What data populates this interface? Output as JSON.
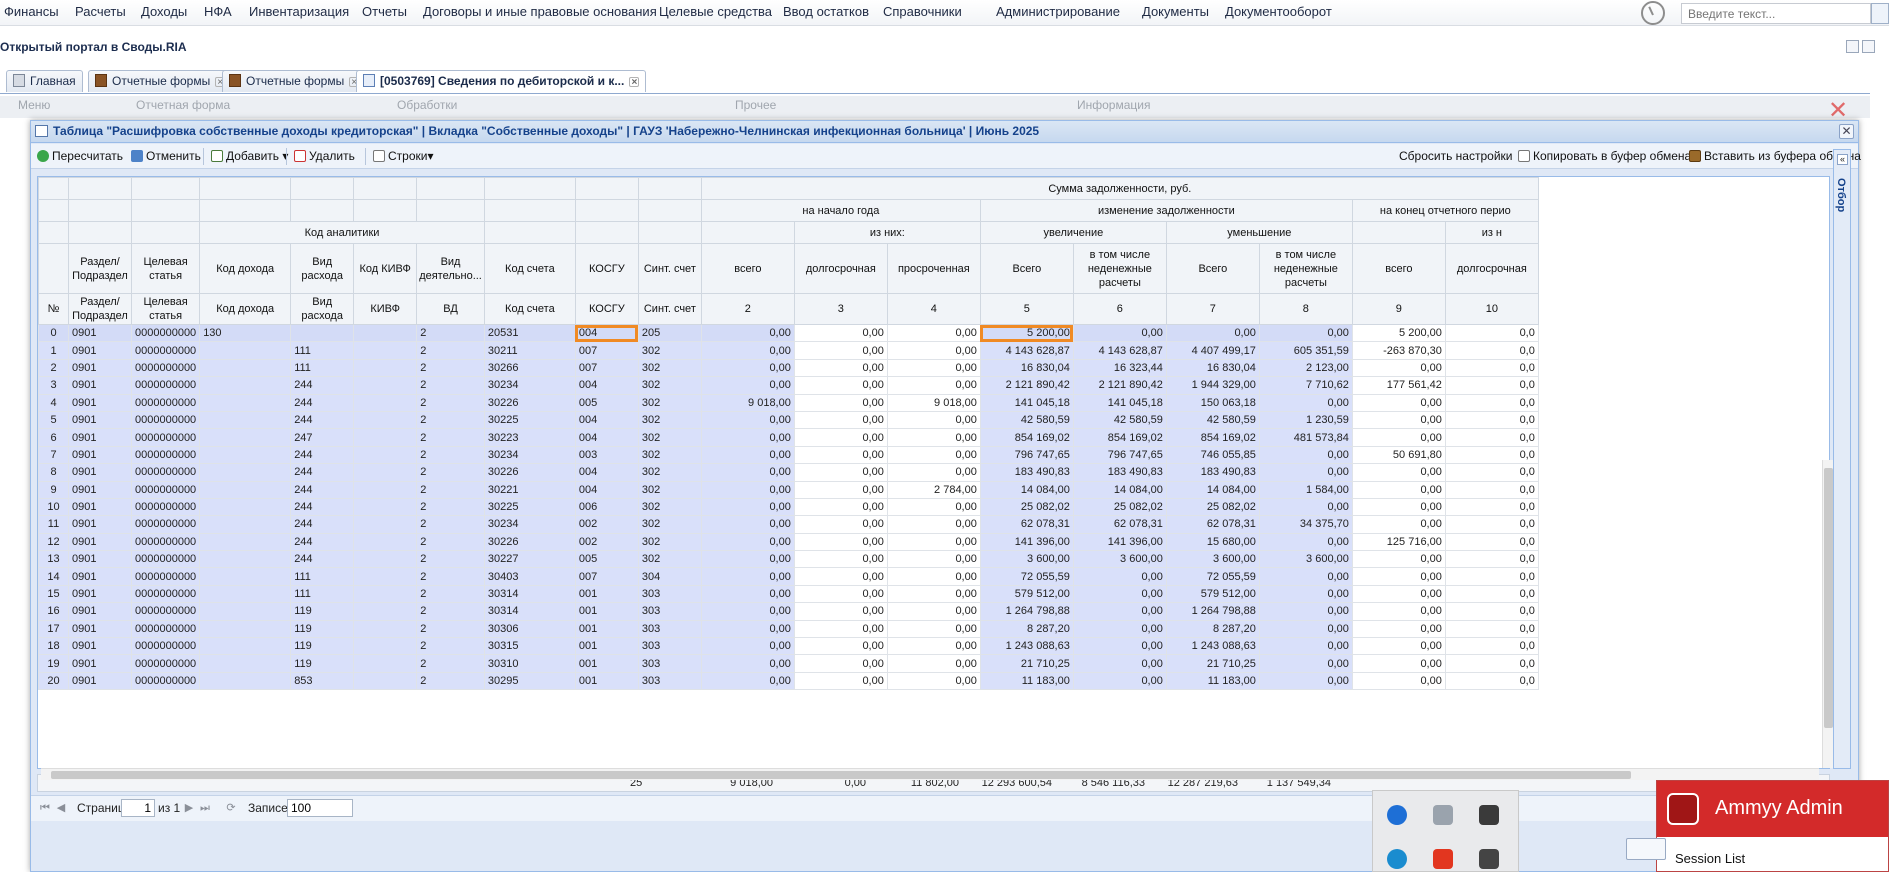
{
  "top_menu": {
    "items": [
      "Финансы",
      "Расчеты",
      "Доходы",
      "НФА",
      "Инвентаризация",
      "Отчеты",
      "Договоры и иные правовые основания",
      "Целевые средства",
      "Ввод остатков",
      "Справочники",
      "Администрирование",
      "Документы",
      "Документооборот"
    ],
    "search_placeholder": "Введите текст..."
  },
  "portal_title": "Открытый портал в Своды.RIA",
  "tabs": [
    {
      "label": "Главная"
    },
    {
      "label": "Отчетные формы"
    },
    {
      "label": "Отчетные формы"
    },
    {
      "label": "[0503769] Сведения по дебиторской и к..."
    }
  ],
  "ribbon": {
    "groups": [
      "Меню",
      "Отчетная форма",
      "Обработки",
      "Прочее",
      "Информация"
    ]
  },
  "modal": {
    "title": "Таблица \"Расшифровка собственные доходы кредиторская\" | Вкладка \"Собственные доходы\" | ГАУЗ 'Набережно-Челнинская инфекционная больница' | Июнь 2025",
    "toolbar": {
      "recalc": "Пересчитать",
      "cancel": "Отменить",
      "add": "Добавить",
      "delete": "Удалить",
      "rows": "Строки",
      "reset": "Сбросить настройки",
      "copy": "Копировать в буфер обмена",
      "paste": "Вставить из буфера обмена"
    },
    "side_filter": "Отбор"
  },
  "grid": {
    "header": {
      "sum_group": "Сумма задолженности, руб.",
      "start_year": "на начало года",
      "of_them": "из них:",
      "change": "изменение задолженности",
      "end_period": "на конец отчетного перио",
      "code_analytics": "Код аналитики",
      "increase": "увеличение",
      "decrease": "уменьшение",
      "of_them_end": "из н"
    },
    "columns": [
      {
        "h1": "",
        "h2": "№"
      },
      {
        "h1": "Раздел/ Подраздел",
        "h2": "Раздел/ Подраздел"
      },
      {
        "h1": "Целевая статья",
        "h2": "Целевая статья"
      },
      {
        "h1": "Код дохода",
        "h2": "Код дохода"
      },
      {
        "h1": "Вид расхода",
        "h2": "Вид расхода"
      },
      {
        "h1": "Код КИВФ",
        "h2": "КИВФ"
      },
      {
        "h1": "Вид деятельно...",
        "h2": "ВД"
      },
      {
        "h1": "Код счета",
        "h2": "Код счета"
      },
      {
        "h1": "КОСГУ",
        "h2": "КОСГУ"
      },
      {
        "h1": "Синт. счет",
        "h2": "Синт. счет"
      },
      {
        "h1": "всего",
        "h2": "2"
      },
      {
        "h1": "долгосрочная",
        "h2": "3"
      },
      {
        "h1": "просроченная",
        "h2": "4"
      },
      {
        "h1": "Всего",
        "h2": "5"
      },
      {
        "h1": "в том числе неденежные расчеты",
        "h2": "6"
      },
      {
        "h1": "Всего",
        "h2": "7"
      },
      {
        "h1": "в том числе неденежные расчеты",
        "h2": "8"
      },
      {
        "h1": "всего",
        "h2": "9"
      },
      {
        "h1": "долгосрочная",
        "h2": "10"
      }
    ],
    "rows": [
      [
        "0",
        "0901",
        "0000000000",
        "130",
        "",
        "",
        "2",
        "20531",
        "004",
        "205",
        "0,00",
        "0,00",
        "0,00",
        "5 200,00",
        "0,00",
        "0,00",
        "0,00",
        "5 200,00",
        "0,0"
      ],
      [
        "1",
        "0901",
        "0000000000",
        "",
        "111",
        "",
        "2",
        "30211",
        "007",
        "302",
        "0,00",
        "0,00",
        "0,00",
        "4 143 628,87",
        "4 143 628,87",
        "4 407 499,17",
        "605 351,59",
        "-263 870,30",
        "0,0"
      ],
      [
        "2",
        "0901",
        "0000000000",
        "",
        "111",
        "",
        "2",
        "30266",
        "007",
        "302",
        "0,00",
        "0,00",
        "0,00",
        "16 830,04",
        "16 323,44",
        "16 830,04",
        "2 123,00",
        "0,00",
        "0,0"
      ],
      [
        "3",
        "0901",
        "0000000000",
        "",
        "244",
        "",
        "2",
        "30234",
        "004",
        "302",
        "0,00",
        "0,00",
        "0,00",
        "2 121 890,42",
        "2 121 890,42",
        "1 944 329,00",
        "7 710,62",
        "177 561,42",
        "0,0"
      ],
      [
        "4",
        "0901",
        "0000000000",
        "",
        "244",
        "",
        "2",
        "30226",
        "005",
        "302",
        "9 018,00",
        "0,00",
        "9 018,00",
        "141 045,18",
        "141 045,18",
        "150 063,18",
        "0,00",
        "0,00",
        "0,0"
      ],
      [
        "5",
        "0901",
        "0000000000",
        "",
        "244",
        "",
        "2",
        "30225",
        "004",
        "302",
        "0,00",
        "0,00",
        "0,00",
        "42 580,59",
        "42 580,59",
        "42 580,59",
        "1 230,59",
        "0,00",
        "0,0"
      ],
      [
        "6",
        "0901",
        "0000000000",
        "",
        "247",
        "",
        "2",
        "30223",
        "004",
        "302",
        "0,00",
        "0,00",
        "0,00",
        "854 169,02",
        "854 169,02",
        "854 169,02",
        "481 573,84",
        "0,00",
        "0,0"
      ],
      [
        "7",
        "0901",
        "0000000000",
        "",
        "244",
        "",
        "2",
        "30234",
        "003",
        "302",
        "0,00",
        "0,00",
        "0,00",
        "796 747,65",
        "796 747,65",
        "746 055,85",
        "0,00",
        "50 691,80",
        "0,0"
      ],
      [
        "8",
        "0901",
        "0000000000",
        "",
        "244",
        "",
        "2",
        "30226",
        "004",
        "302",
        "0,00",
        "0,00",
        "0,00",
        "183 490,83",
        "183 490,83",
        "183 490,83",
        "0,00",
        "0,00",
        "0,0"
      ],
      [
        "9",
        "0901",
        "0000000000",
        "",
        "244",
        "",
        "2",
        "30221",
        "004",
        "302",
        "0,00",
        "0,00",
        "2 784,00",
        "14 084,00",
        "14 084,00",
        "14 084,00",
        "1 584,00",
        "0,00",
        "0,0"
      ],
      [
        "10",
        "0901",
        "0000000000",
        "",
        "244",
        "",
        "2",
        "30225",
        "006",
        "302",
        "0,00",
        "0,00",
        "0,00",
        "25 082,02",
        "25 082,02",
        "25 082,02",
        "0,00",
        "0,00",
        "0,0"
      ],
      [
        "11",
        "0901",
        "0000000000",
        "",
        "244",
        "",
        "2",
        "30234",
        "002",
        "302",
        "0,00",
        "0,00",
        "0,00",
        "62 078,31",
        "62 078,31",
        "62 078,31",
        "34 375,70",
        "0,00",
        "0,0"
      ],
      [
        "12",
        "0901",
        "0000000000",
        "",
        "244",
        "",
        "2",
        "30226",
        "002",
        "302",
        "0,00",
        "0,00",
        "0,00",
        "141 396,00",
        "141 396,00",
        "15 680,00",
        "0,00",
        "125 716,00",
        "0,0"
      ],
      [
        "13",
        "0901",
        "0000000000",
        "",
        "244",
        "",
        "2",
        "30227",
        "005",
        "302",
        "0,00",
        "0,00",
        "0,00",
        "3 600,00",
        "3 600,00",
        "3 600,00",
        "3 600,00",
        "0,00",
        "0,0"
      ],
      [
        "14",
        "0901",
        "0000000000",
        "",
        "111",
        "",
        "2",
        "30403",
        "007",
        "304",
        "0,00",
        "0,00",
        "0,00",
        "72 055,59",
        "0,00",
        "72 055,59",
        "0,00",
        "0,00",
        "0,0"
      ],
      [
        "15",
        "0901",
        "0000000000",
        "",
        "111",
        "",
        "2",
        "30314",
        "001",
        "303",
        "0,00",
        "0,00",
        "0,00",
        "579 512,00",
        "0,00",
        "579 512,00",
        "0,00",
        "0,00",
        "0,0"
      ],
      [
        "16",
        "0901",
        "0000000000",
        "",
        "119",
        "",
        "2",
        "30314",
        "001",
        "303",
        "0,00",
        "0,00",
        "0,00",
        "1 264 798,88",
        "0,00",
        "1 264 798,88",
        "0,00",
        "0,00",
        "0,0"
      ],
      [
        "17",
        "0901",
        "0000000000",
        "",
        "119",
        "",
        "2",
        "30306",
        "001",
        "303",
        "0,00",
        "0,00",
        "0,00",
        "8 287,20",
        "0,00",
        "8 287,20",
        "0,00",
        "0,00",
        "0,0"
      ],
      [
        "18",
        "0901",
        "0000000000",
        "",
        "119",
        "",
        "2",
        "30315",
        "001",
        "303",
        "0,00",
        "0,00",
        "0,00",
        "1 243 088,63",
        "0,00",
        "1 243 088,63",
        "0,00",
        "0,00",
        "0,0"
      ],
      [
        "19",
        "0901",
        "0000000000",
        "",
        "119",
        "",
        "2",
        "30310",
        "001",
        "303",
        "0,00",
        "0,00",
        "0,00",
        "21 710,25",
        "0,00",
        "21 710,25",
        "0,00",
        "0,00",
        "0,0"
      ],
      [
        "20",
        "0901",
        "0000000000",
        "",
        "853",
        "",
        "2",
        "30295",
        "001",
        "303",
        "0,00",
        "0,00",
        "0,00",
        "11 183,00",
        "0,00",
        "11 183,00",
        "0,00",
        "0,00",
        "0,0"
      ]
    ],
    "totals": {
      "synt": "25",
      "c2": "9 018,00",
      "c3": "0,00",
      "c4": "11 802,00",
      "c5": "12 293 600,54",
      "c6": "8 546 116,33",
      "c7": "12 287 219,63",
      "c8": "1 137 549,34"
    }
  },
  "pager": {
    "page_label": "Страница",
    "page": "1",
    "of_label": "из 1",
    "records_label": "Записей",
    "records": "100"
  },
  "ammyy": {
    "title": "Ammyy Admin",
    "session": "Session List"
  }
}
